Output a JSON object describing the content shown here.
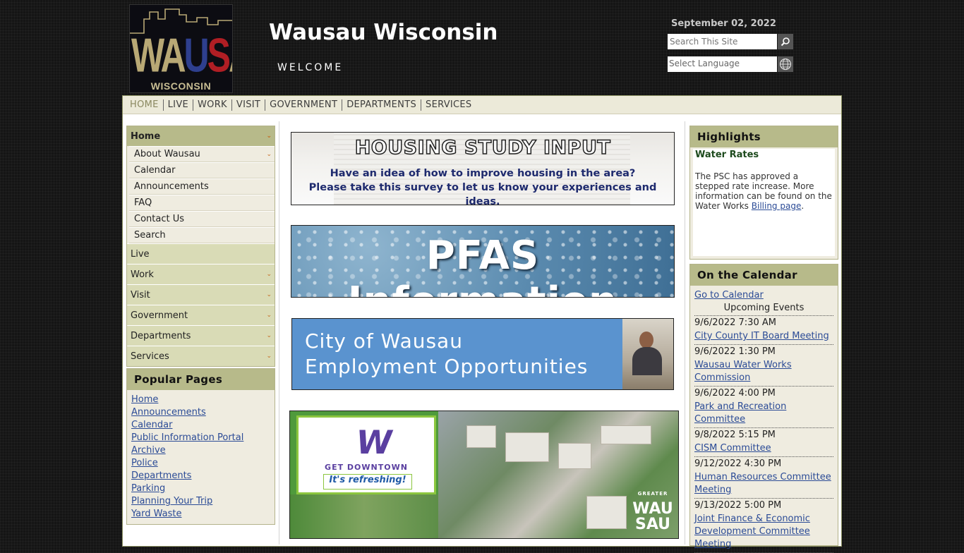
{
  "header": {
    "logo_text": "WAUSAU",
    "logo_sub": "WISCONSIN",
    "site_title": "Wausau Wisconsin",
    "welcome": "WELCOME",
    "date": "September 02, 2022",
    "search_placeholder": "Search This Site",
    "language_label": "Select Language"
  },
  "topnav": [
    "HOME",
    "LIVE",
    "WORK",
    "VISIT",
    "GOVERNMENT",
    "DEPARTMENTS",
    "SERVICES"
  ],
  "leftnav": {
    "home": "Home",
    "home_sub": [
      "About Wausau",
      "Calendar",
      "Announcements",
      "FAQ",
      "Contact Us",
      "Search"
    ],
    "sections": [
      "Live",
      "Work",
      "Visit",
      "Government",
      "Departments",
      "Services"
    ]
  },
  "popular": {
    "title": "Popular Pages",
    "links": [
      "Home",
      "Announcements",
      "Calendar",
      "Public Information Portal",
      "Archive",
      "Police",
      "Departments",
      "Parking",
      "Planning Your Trip",
      "Yard Waste"
    ]
  },
  "banners": {
    "housing_title": "HOUSING STUDY INPUT",
    "housing_line1": "Have an idea of how to improve housing in the area?",
    "housing_line2": "Please take this survey to let us know your experiences and ideas.",
    "pfas": "PFAS Information",
    "employment_line1": "City of Wausau",
    "employment_line2": "Employment Opportunities",
    "downtown_line1": "GET DOWNTOWN",
    "downtown_line2": "It's refreshing!",
    "greater": "GREATER",
    "wau": "WAU",
    "sau": "SAU"
  },
  "highlights": {
    "title": "Highlights",
    "item_title": "Water Rates",
    "item_text": "The PSC has approved a stepped rate increase. More information can be found on the Water Works ",
    "item_link": "Billing page",
    "item_end": "."
  },
  "calendar": {
    "title": "On the Calendar",
    "goto": "Go to Calendar",
    "upcoming": "Upcoming Events",
    "events": [
      {
        "date": "9/6/2022 7:30 AM",
        "title": "City County IT Board Meeting"
      },
      {
        "date": "9/6/2022 1:30 PM",
        "title": "Wausau Water Works Commission"
      },
      {
        "date": "9/6/2022 4:00 PM",
        "title": "Park and Recreation Committee"
      },
      {
        "date": "9/8/2022 5:15 PM",
        "title": "CISM Committee"
      },
      {
        "date": "9/12/2022 4:30 PM",
        "title": "Human Resources Committee Meeting"
      },
      {
        "date": "9/13/2022 5:00 PM",
        "title": "Joint Finance & Economic Development Committee Meeting"
      }
    ]
  },
  "colors": {
    "accent": "#b7ba8a",
    "link": "#2b4b96",
    "orange_chevron": "#c46a1f"
  }
}
